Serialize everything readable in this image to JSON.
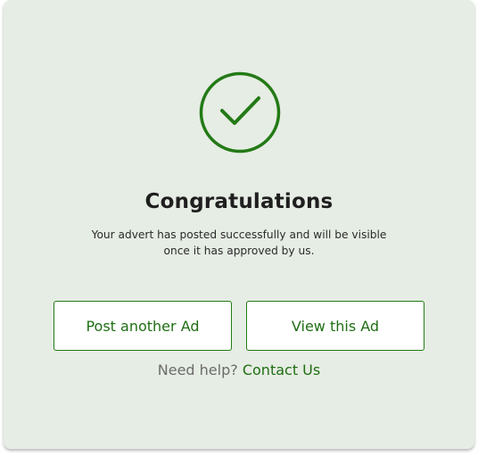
{
  "colors": {
    "card_background": "#e6ede4",
    "accent": "#237a16",
    "title": "#1f1f1f",
    "muted": "#6b6b6b"
  },
  "success": {
    "icon": "check-circle-icon",
    "title": "Congratulations",
    "message_line1": "Your advert has posted successfully and will be visible",
    "message_line2": "once it has approved by us."
  },
  "actions": {
    "post_another_label": "Post another Ad",
    "view_ad_label": "View this Ad"
  },
  "help": {
    "prompt": "Need help?",
    "link_label": "Contact Us"
  }
}
